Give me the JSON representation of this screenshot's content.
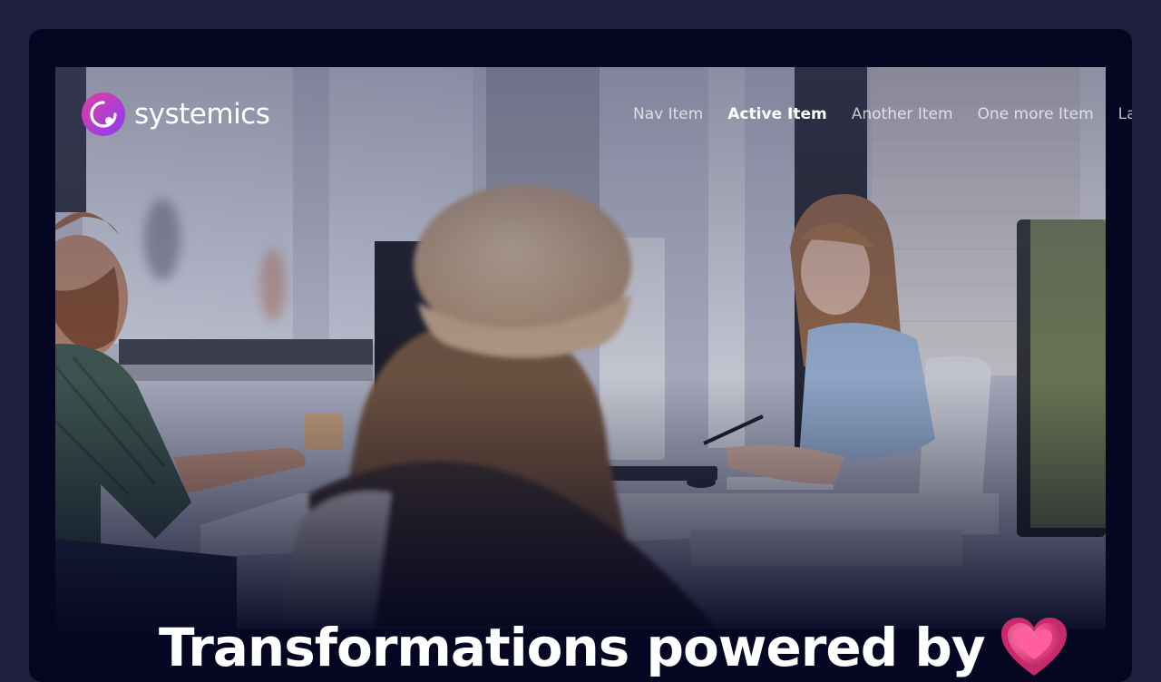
{
  "brand": {
    "name": "systemics",
    "logo_icon": "orbit-ring-icon",
    "gradient_colors": [
      "#e040a0",
      "#8a3cf5"
    ]
  },
  "nav": {
    "items": [
      {
        "label": "Nav Item",
        "active": false
      },
      {
        "label": "Active Item",
        "active": true
      },
      {
        "label": "Another Item",
        "active": false
      },
      {
        "label": "One more Item",
        "active": false
      },
      {
        "label": "Last Item",
        "active": false
      }
    ]
  },
  "hero": {
    "headline": "Transformations powered by",
    "headline_icon": "heart-icon",
    "photo_subject": "office-team-photo"
  },
  "colors": {
    "page_background": "#1f2040",
    "frame_background": "#050622",
    "heart": "#e0417f"
  }
}
